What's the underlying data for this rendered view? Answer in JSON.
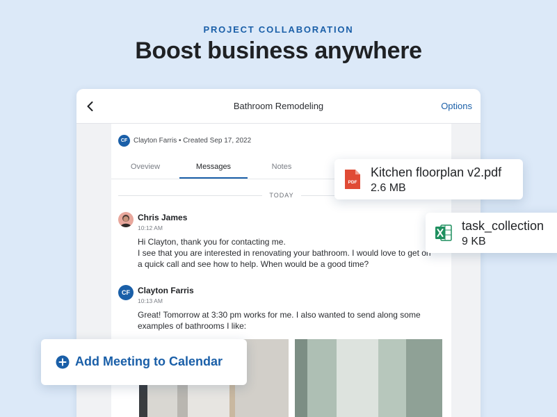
{
  "hero": {
    "eyebrow": "PROJECT COLLABORATION",
    "headline": "Boost business anywhere"
  },
  "header": {
    "title": "Bathroom Remodeling",
    "options_label": "Options"
  },
  "project": {
    "owner_initials": "CF",
    "meta": "Clayton Farris • Created Sep 17, 2022"
  },
  "tabs": [
    {
      "label": "Oveview",
      "active": false
    },
    {
      "label": "Messages",
      "active": true
    },
    {
      "label": "Notes",
      "active": false
    }
  ],
  "messages_divider": "TODAY",
  "messages": [
    {
      "author": "Chris James",
      "time": "10:12 AM",
      "body": "Hi Clayton, thank you for contacting me.\nI see that you are interested in renovating your bathroom. I would love to get on a quick call and see how to help. When would be a good time?"
    },
    {
      "author": "Clayton Farris",
      "initials": "CF",
      "time": "10:13 AM",
      "body": "Great! Tomorrow at 3:30 pm works for me. I also wanted to send along some examples of bathrooms I like:"
    }
  ],
  "files": [
    {
      "name": "Kitchen floorplan v2.pdf",
      "size": "2.6 MB",
      "icon": "pdf-file-icon",
      "icon_label": "PDF"
    },
    {
      "name": "task_collection",
      "size": "9 KB",
      "icon": "excel-file-icon"
    }
  ],
  "calendar_action": {
    "label": "Add Meeting to Calendar",
    "icon": "plus-circle-icon"
  },
  "colors": {
    "accent": "#1a5fa8",
    "background": "#dce9f8",
    "pdf": "#e04b35",
    "excel": "#1f8f5f"
  }
}
